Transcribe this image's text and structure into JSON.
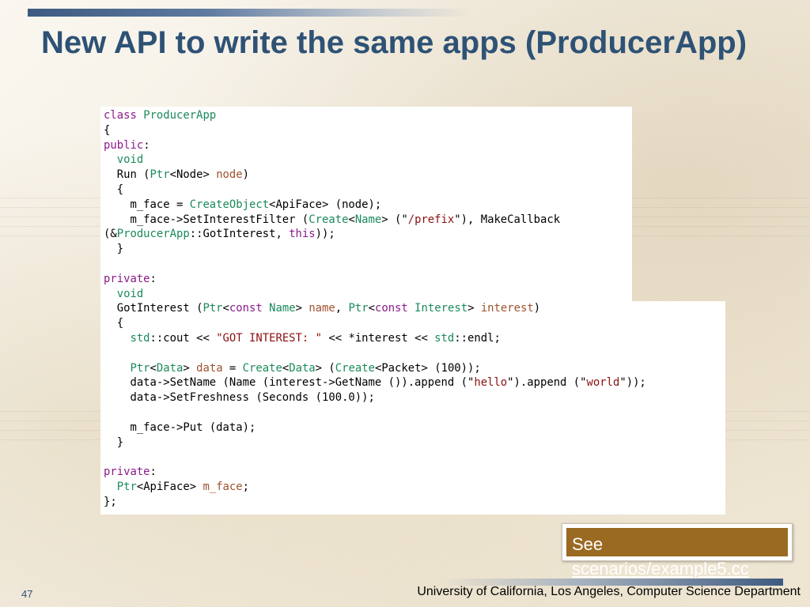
{
  "slide": {
    "title": "New API to write the same apps (ProducerApp)",
    "page_number": "47",
    "footer": "University of California, Los Angeles, Computer Science Department",
    "note": {
      "prefix": "See",
      "link": "scenarios/example5.cc"
    }
  },
  "code_lines": [
    [
      {
        "t": "class",
        "c": "kw"
      },
      {
        "t": " "
      },
      {
        "t": "ProducerApp",
        "c": "ty"
      }
    ],
    [
      {
        "t": "{"
      }
    ],
    [
      {
        "t": "public",
        "c": "kw"
      },
      {
        "t": ":"
      }
    ],
    [
      {
        "t": "  "
      },
      {
        "t": "void",
        "c": "ty"
      }
    ],
    [
      {
        "t": "  Run ("
      },
      {
        "t": "Ptr",
        "c": "ty"
      },
      {
        "t": "<Node> "
      },
      {
        "t": "node",
        "c": "vr"
      },
      {
        "t": ")"
      }
    ],
    [
      {
        "t": "  {"
      }
    ],
    [
      {
        "t": "    m_face = "
      },
      {
        "t": "CreateObject",
        "c": "ty"
      },
      {
        "t": "<ApiFace> (node);"
      }
    ],
    [
      {
        "t": "    m_face->SetInterestFilter ("
      },
      {
        "t": "Create",
        "c": "ty"
      },
      {
        "t": "<"
      },
      {
        "t": "Name",
        "c": "ty"
      },
      {
        "t": "> (\""
      },
      {
        "t": "/prefix",
        "c": "st"
      },
      {
        "t": "\"), MakeCallback"
      }
    ],
    [
      {
        "t": "(&"
      },
      {
        "t": "ProducerApp",
        "c": "ty"
      },
      {
        "t": "::GotInterest, "
      },
      {
        "t": "this",
        "c": "kw"
      },
      {
        "t": "));"
      }
    ],
    [
      {
        "t": "  }"
      }
    ],
    [
      {
        "t": ""
      }
    ],
    [
      {
        "t": "private",
        "c": "kw"
      },
      {
        "t": ":"
      }
    ],
    [
      {
        "t": "  "
      },
      {
        "t": "void",
        "c": "ty"
      }
    ],
    [
      {
        "t": "  GotInterest ("
      },
      {
        "t": "Ptr",
        "c": "ty"
      },
      {
        "t": "<"
      },
      {
        "t": "const",
        "c": "kw"
      },
      {
        "t": " "
      },
      {
        "t": "Name",
        "c": "ty"
      },
      {
        "t": "> "
      },
      {
        "t": "name",
        "c": "vr"
      },
      {
        "t": ", "
      },
      {
        "t": "Ptr",
        "c": "ty"
      },
      {
        "t": "<"
      },
      {
        "t": "const",
        "c": "kw"
      },
      {
        "t": " "
      },
      {
        "t": "Interest",
        "c": "ty"
      },
      {
        "t": "> "
      },
      {
        "t": "interest",
        "c": "vr"
      },
      {
        "t": ")"
      }
    ],
    [
      {
        "t": "  {"
      }
    ],
    [
      {
        "t": "    "
      },
      {
        "t": "std",
        "c": "ty"
      },
      {
        "t": "::cout << "
      },
      {
        "t": "\"GOT INTEREST: \"",
        "c": "st"
      },
      {
        "t": " << *interest << "
      },
      {
        "t": "std",
        "c": "ty"
      },
      {
        "t": "::endl;"
      }
    ],
    [
      {
        "t": ""
      }
    ],
    [
      {
        "t": "    "
      },
      {
        "t": "Ptr",
        "c": "ty"
      },
      {
        "t": "<"
      },
      {
        "t": "Data",
        "c": "ty"
      },
      {
        "t": "> "
      },
      {
        "t": "data",
        "c": "vr"
      },
      {
        "t": " = "
      },
      {
        "t": "Create",
        "c": "ty"
      },
      {
        "t": "<"
      },
      {
        "t": "Data",
        "c": "ty"
      },
      {
        "t": "> ("
      },
      {
        "t": "Create",
        "c": "ty"
      },
      {
        "t": "<Packet> (100));"
      }
    ],
    [
      {
        "t": "    data->SetName (Name (interest->GetName ()).append (\""
      },
      {
        "t": "hello",
        "c": "st"
      },
      {
        "t": "\").append (\""
      },
      {
        "t": "world",
        "c": "st"
      },
      {
        "t": "\"));"
      }
    ],
    [
      {
        "t": "    data->SetFreshness (Seconds (100.0));"
      }
    ],
    [
      {
        "t": ""
      }
    ],
    [
      {
        "t": "    m_face->Put (data);"
      }
    ],
    [
      {
        "t": "  }"
      }
    ],
    [
      {
        "t": ""
      }
    ],
    [
      {
        "t": "private",
        "c": "kw"
      },
      {
        "t": ":"
      }
    ],
    [
      {
        "t": "  "
      },
      {
        "t": "Ptr",
        "c": "ty"
      },
      {
        "t": "<ApiFace> "
      },
      {
        "t": "m_face",
        "c": "vr"
      },
      {
        "t": ";"
      }
    ],
    [
      {
        "t": "};"
      }
    ]
  ]
}
